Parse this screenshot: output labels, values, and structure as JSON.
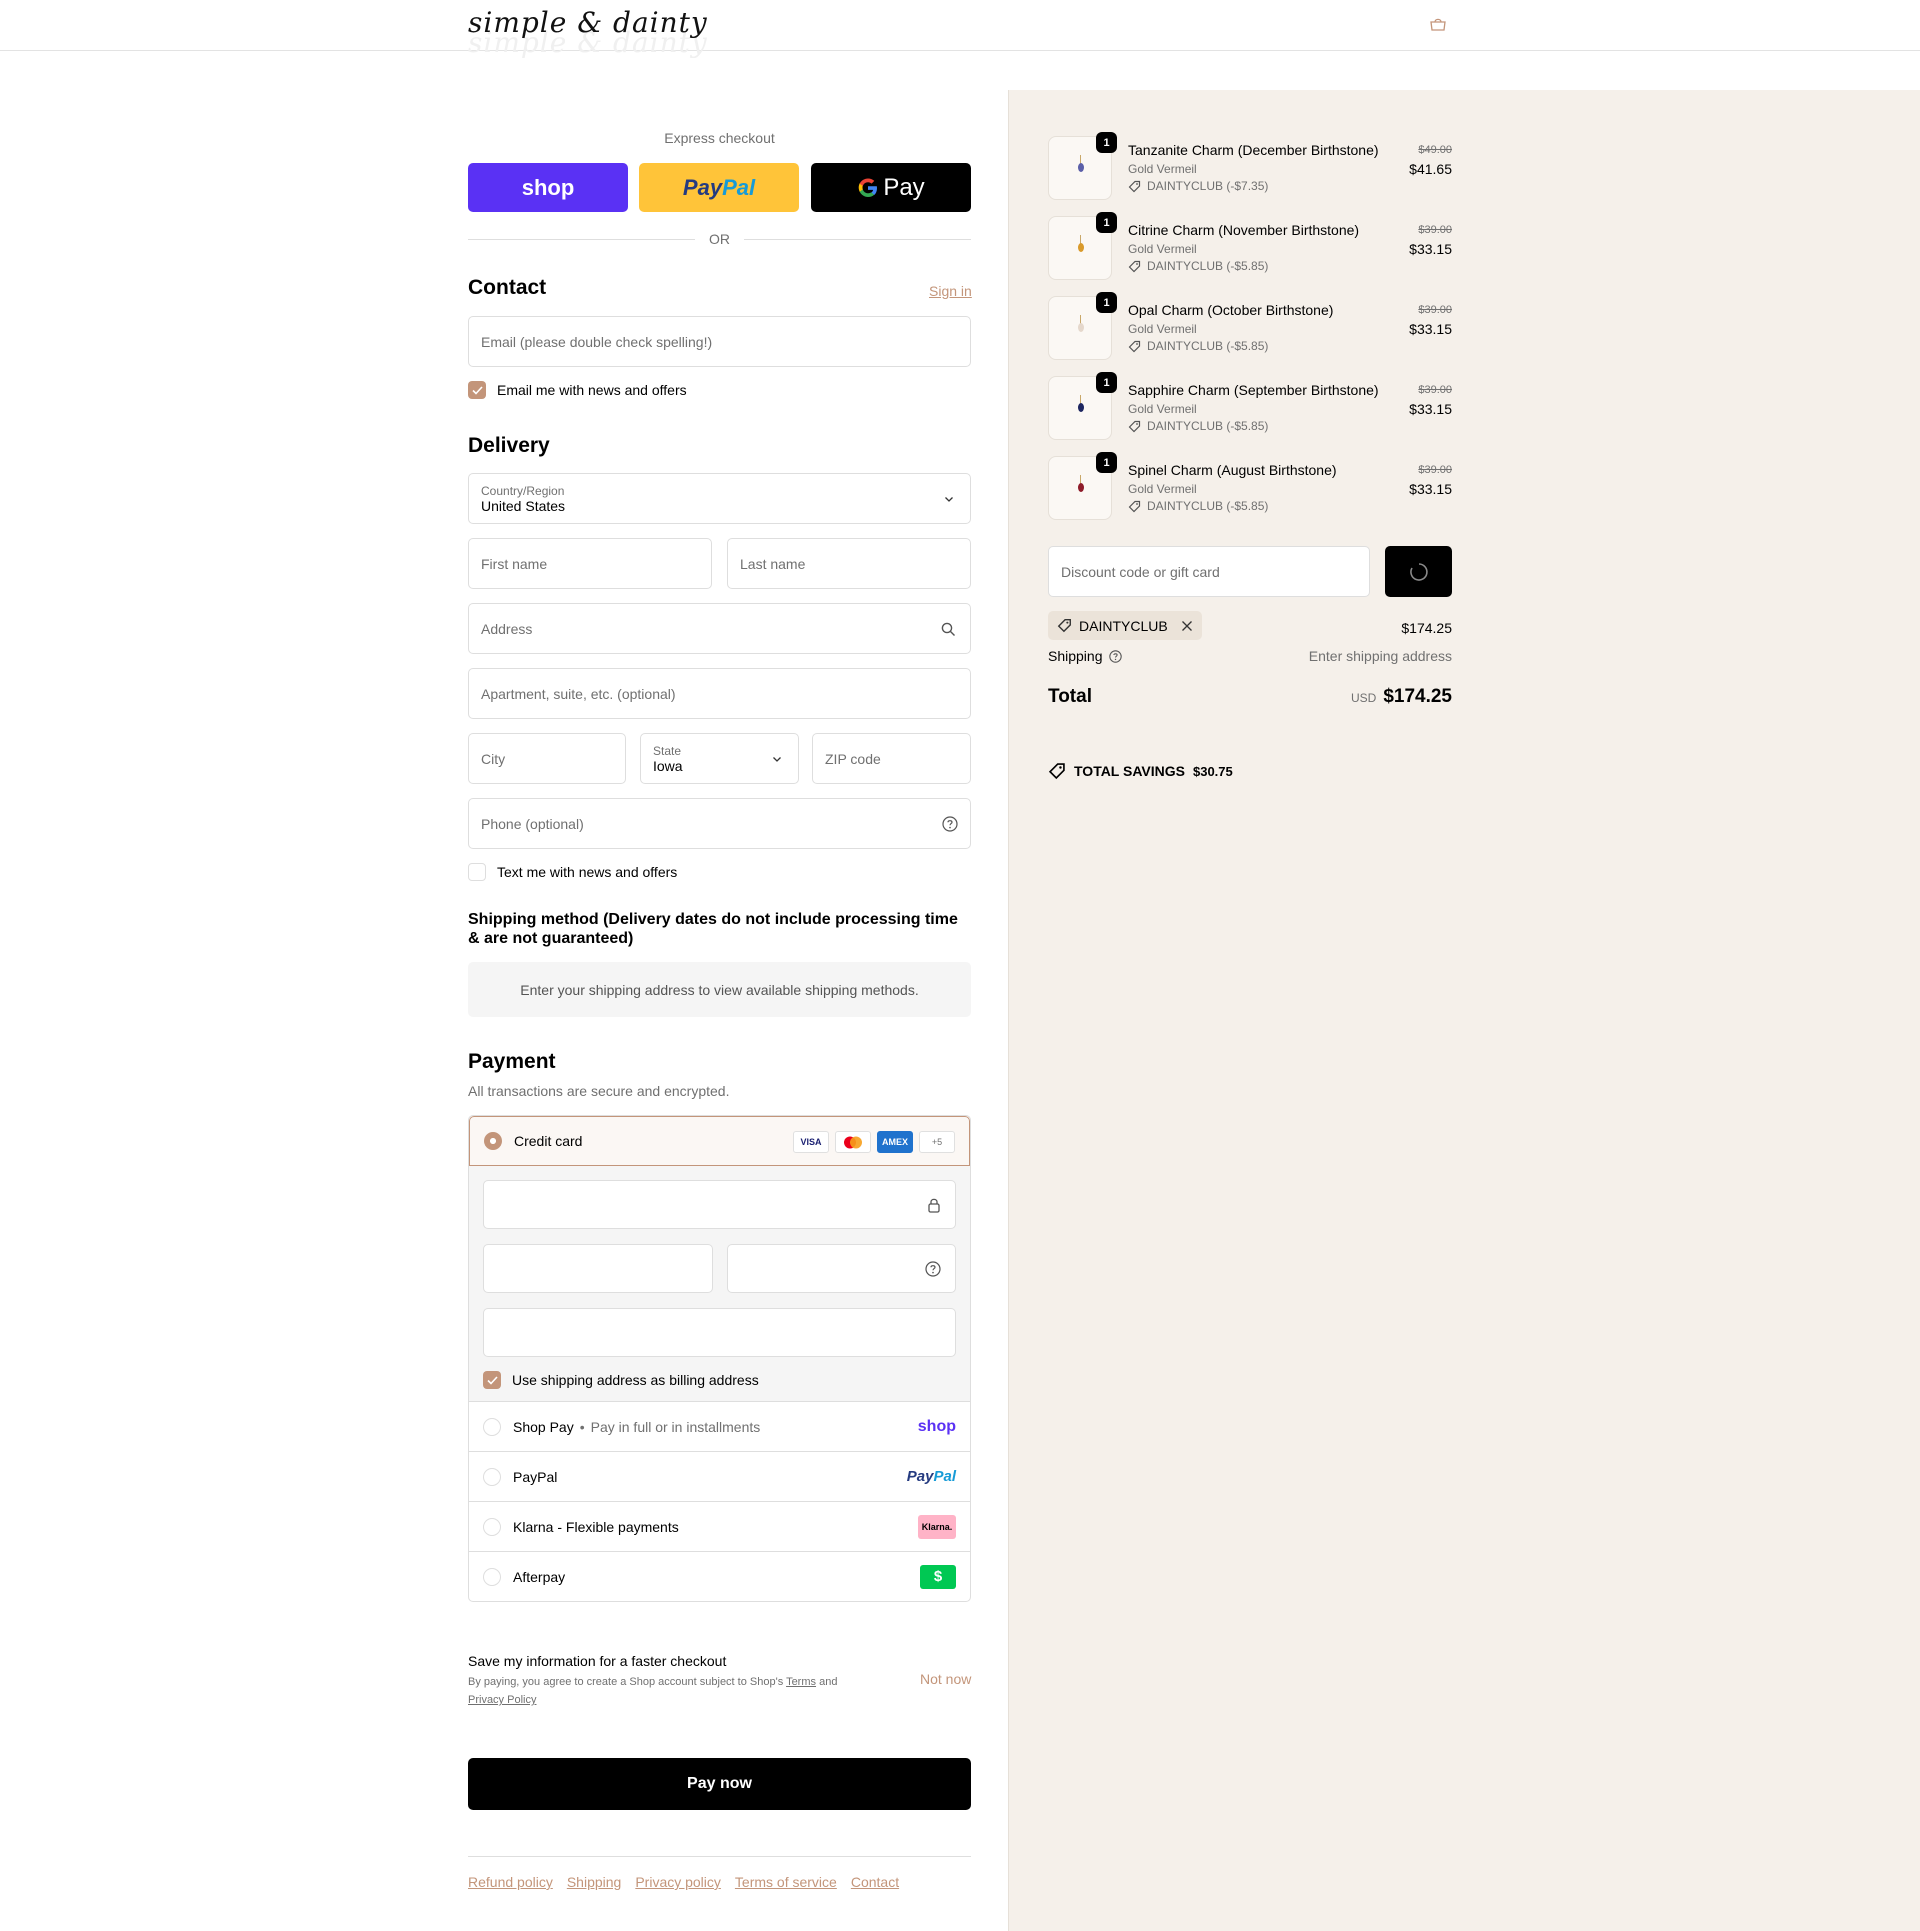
{
  "header": {
    "logo": "simple & dainty"
  },
  "express": {
    "label": "Express checkout",
    "shop_label": "shop",
    "paypal_label_1": "Pay",
    "paypal_label_2": "Pal",
    "gpay_label": "Pay",
    "or": "OR"
  },
  "contact": {
    "title": "Contact",
    "sign_in": "Sign in",
    "email_placeholder": "Email (please double check spelling!)",
    "news_label": "Email me with news and offers"
  },
  "delivery": {
    "title": "Delivery",
    "country_label": "Country/Region",
    "country_value": "United States",
    "first_name": "First name",
    "last_name": "Last name",
    "address": "Address",
    "apartment": "Apartment, suite, etc. (optional)",
    "city": "City",
    "state_label": "State",
    "state_value": "Iowa",
    "zip": "ZIP code",
    "phone": "Phone (optional)",
    "text_label": "Text me with news and offers"
  },
  "shipping_method": {
    "title": "Shipping method (Delivery dates do not include processing time & are not guaranteed)",
    "message": "Enter your shipping address to view available shipping methods."
  },
  "payment": {
    "title": "Payment",
    "subtitle": "All transactions are secure and encrypted.",
    "credit_card": "Credit card",
    "cards": [
      "VISA",
      "AMEX",
      "+5"
    ],
    "billing_label": "Use shipping address as billing address",
    "shop_pay": "Shop Pay",
    "shop_pay_sub": "Pay in full or in installments",
    "shop_pay_logo": "shop",
    "paypal": "PayPal",
    "paypal_logo_1": "Pay",
    "paypal_logo_2": "Pal",
    "klarna": "Klarna - Flexible payments",
    "klarna_logo": "Klarna.",
    "afterpay": "Afterpay",
    "afterpay_logo": "$"
  },
  "save_info": {
    "title": "Save my information for a faster checkout",
    "text_1": "By paying, you agree to create a Shop account subject to Shop's",
    "terms": "Terms",
    "and": "and",
    "privacy": "Privacy Policy",
    "not_now": "Not now"
  },
  "pay_now": "Pay now",
  "footer": [
    "Refund policy",
    "Shipping",
    "Privacy policy",
    "Terms of service",
    "Contact"
  ],
  "order": {
    "items": [
      {
        "qty": "1",
        "name": "Tanzanite Charm (December Birthstone)",
        "variant": "Gold Vermeil",
        "discount": "DAINTYCLUB (-$7.35)",
        "old_price": "$49.00",
        "price": "$41.65",
        "gem_color": "#5b5fa8"
      },
      {
        "qty": "1",
        "name": "Citrine Charm (November Birthstone)",
        "variant": "Gold Vermeil",
        "discount": "DAINTYCLUB (-$5.85)",
        "old_price": "$39.00",
        "price": "$33.15",
        "gem_color": "#d99a2b"
      },
      {
        "qty": "1",
        "name": "Opal Charm (October Birthstone)",
        "variant": "Gold Vermeil",
        "discount": "DAINTYCLUB (-$5.85)",
        "old_price": "$39.00",
        "price": "$33.15",
        "gem_color": "#e5d8cc"
      },
      {
        "qty": "1",
        "name": "Sapphire Charm (September Birthstone)",
        "variant": "Gold Vermeil",
        "discount": "DAINTYCLUB (-$5.85)",
        "old_price": "$39.00",
        "price": "$33.15",
        "gem_color": "#1d2660"
      },
      {
        "qty": "1",
        "name": "Spinel Charm (August Birthstone)",
        "variant": "Gold Vermeil",
        "discount": "DAINTYCLUB (-$5.85)",
        "old_price": "$39.00",
        "price": "$33.15",
        "gem_color": "#8e1c2a"
      }
    ],
    "discount_placeholder": "Discount code or gift card",
    "applied_code": "DAINTYCLUB",
    "subtotal": "$174.25",
    "shipping_label": "Shipping",
    "shipping_value": "Enter shipping address",
    "total_label": "Total",
    "currency": "USD",
    "total": "$174.25",
    "savings_label": "TOTAL SAVINGS",
    "savings_value": "$30.75"
  },
  "colors": {
    "accent": "#c3957a",
    "shop_purple": "#5a31f4",
    "paypal_yellow": "#ffc439",
    "right_bg": "#f5f0ea"
  }
}
